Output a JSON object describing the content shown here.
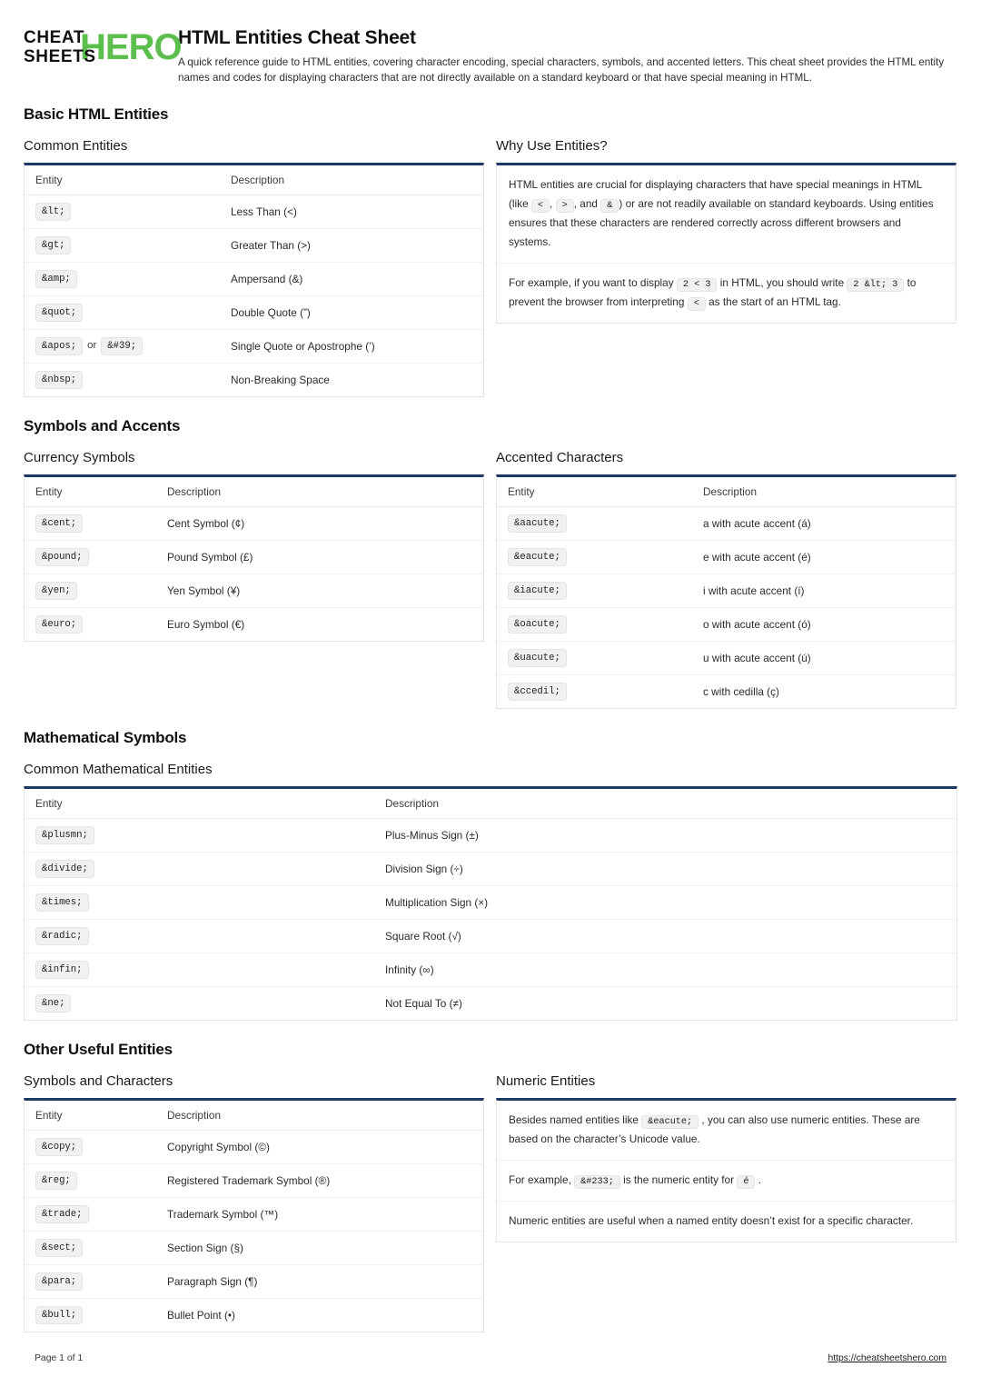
{
  "brand": {
    "logo_line1": "CHEAT",
    "logo_line2": "SHEETS",
    "logo_accent": "HERO",
    "accent_color": "#5cbf4d",
    "rule_color": "#1f3864"
  },
  "header": {
    "title": "HTML Entities Cheat Sheet",
    "subtitle": "A quick reference guide to HTML entities, covering character encoding, special characters, symbols, and accented letters. This cheat sheet provides the HTML entity names and codes for displaying characters that are not directly available on a standard keyboard or that have special meaning in HTML."
  },
  "sections": {
    "basic": {
      "title": "Basic HTML Entities",
      "common_entities": {
        "title": "Common Entities",
        "columns": [
          "Entity",
          "Description"
        ],
        "rows": [
          {
            "entity": "&lt;",
            "alt": null,
            "description": "Less Than (<)"
          },
          {
            "entity": "&gt;",
            "alt": null,
            "description": "Greater Than (>)"
          },
          {
            "entity": "&amp;",
            "alt": null,
            "description": "Ampersand (&)"
          },
          {
            "entity": "&quot;",
            "alt": null,
            "description": "Double Quote (”)"
          },
          {
            "entity": "&apos;",
            "alt": "&#39;",
            "or_label": "or",
            "description": "Single Quote or Apostrophe (’)"
          },
          {
            "entity": "&nbsp;",
            "alt": null,
            "description": "Non-Breaking Space"
          }
        ]
      },
      "why_use": {
        "title": "Why Use Entities?",
        "paragraphs": [
          {
            "parts": [
              {
                "type": "text",
                "value": "HTML entities are crucial for displaying characters that have special meanings in HTML (like "
              },
              {
                "type": "code",
                "value": "<"
              },
              {
                "type": "text",
                "value": ", "
              },
              {
                "type": "code",
                "value": ">"
              },
              {
                "type": "text",
                "value": ", and "
              },
              {
                "type": "code",
                "value": "&"
              },
              {
                "type": "text",
                "value": ") or are not readily available on standard keyboards. Using entities ensures that these characters are rendered correctly across different browsers and systems."
              }
            ]
          },
          {
            "parts": [
              {
                "type": "text",
                "value": "For example, if you want to display "
              },
              {
                "type": "code",
                "value": "2 < 3"
              },
              {
                "type": "text",
                "value": " in HTML, you should write "
              },
              {
                "type": "code",
                "value": "2 &lt; 3"
              },
              {
                "type": "text",
                "value": " to prevent the browser from interpreting "
              },
              {
                "type": "code",
                "value": "<"
              },
              {
                "type": "text",
                "value": " as the start of an HTML tag."
              }
            ]
          }
        ]
      }
    },
    "symbols_accents": {
      "title": "Symbols and Accents",
      "currency": {
        "title": "Currency Symbols",
        "columns": [
          "Entity",
          "Description"
        ],
        "rows": [
          {
            "entity": "&cent;",
            "description": "Cent Symbol (¢)"
          },
          {
            "entity": "&pound;",
            "description": "Pound Symbol (£)"
          },
          {
            "entity": "&yen;",
            "description": "Yen Symbol (¥)"
          },
          {
            "entity": "&euro;",
            "description": "Euro Symbol (€)"
          }
        ]
      },
      "accented": {
        "title": "Accented Characters",
        "columns": [
          "Entity",
          "Description"
        ],
        "rows": [
          {
            "entity": "&aacute;",
            "description": "a with acute accent (á)"
          },
          {
            "entity": "&eacute;",
            "description": "e with acute accent (é)"
          },
          {
            "entity": "&iacute;",
            "description": "i with acute accent (í)"
          },
          {
            "entity": "&oacute;",
            "description": "o with acute accent (ó)"
          },
          {
            "entity": "&uacute;",
            "description": "u with acute accent (ú)"
          },
          {
            "entity": "&ccedil;",
            "description": "c with cedilla (ç)"
          }
        ]
      }
    },
    "math": {
      "title": "Mathematical Symbols",
      "common": {
        "title": "Common Mathematical Entities",
        "columns": [
          "Entity",
          "Description"
        ],
        "rows": [
          {
            "entity": "&plusmn;",
            "description": "Plus-Minus Sign (±)"
          },
          {
            "entity": "&divide;",
            "description": "Division Sign (÷)"
          },
          {
            "entity": "&times;",
            "description": "Multiplication Sign (×)"
          },
          {
            "entity": "&radic;",
            "description": "Square Root (√)"
          },
          {
            "entity": "&infin;",
            "description": "Infinity (∞)"
          },
          {
            "entity": "&ne;",
            "description": "Not Equal To (≠)"
          }
        ]
      }
    },
    "other": {
      "title": "Other Useful Entities",
      "symbols_chars": {
        "title": "Symbols and Characters",
        "columns": [
          "Entity",
          "Description"
        ],
        "rows": [
          {
            "entity": "&copy;",
            "description": "Copyright Symbol (©)"
          },
          {
            "entity": "&reg;",
            "description": "Registered Trademark Symbol (®)"
          },
          {
            "entity": "&trade;",
            "description": "Trademark Symbol (™)"
          },
          {
            "entity": "&sect;",
            "description": "Section Sign (§)"
          },
          {
            "entity": "&para;",
            "description": "Paragraph Sign (¶)"
          },
          {
            "entity": "&bull;",
            "description": "Bullet Point (•)"
          }
        ]
      },
      "numeric": {
        "title": "Numeric Entities",
        "paragraphs": [
          {
            "parts": [
              {
                "type": "text",
                "value": "Besides named entities like "
              },
              {
                "type": "code",
                "value": "&eacute;"
              },
              {
                "type": "text",
                "value": " , you can also use numeric entities. These are based on the character’s Unicode value."
              }
            ]
          },
          {
            "parts": [
              {
                "type": "text",
                "value": "For example, "
              },
              {
                "type": "code",
                "value": "&#233;"
              },
              {
                "type": "text",
                "value": " is the numeric entity for "
              },
              {
                "type": "code",
                "value": "é"
              },
              {
                "type": "text",
                "value": " ."
              }
            ]
          },
          {
            "parts": [
              {
                "type": "text",
                "value": "Numeric entities are useful when a named entity doesn’t exist for a specific character."
              }
            ]
          }
        ]
      }
    }
  },
  "footer": {
    "page_label": "Page 1 of 1",
    "url": "https://cheatsheetshero.com"
  }
}
